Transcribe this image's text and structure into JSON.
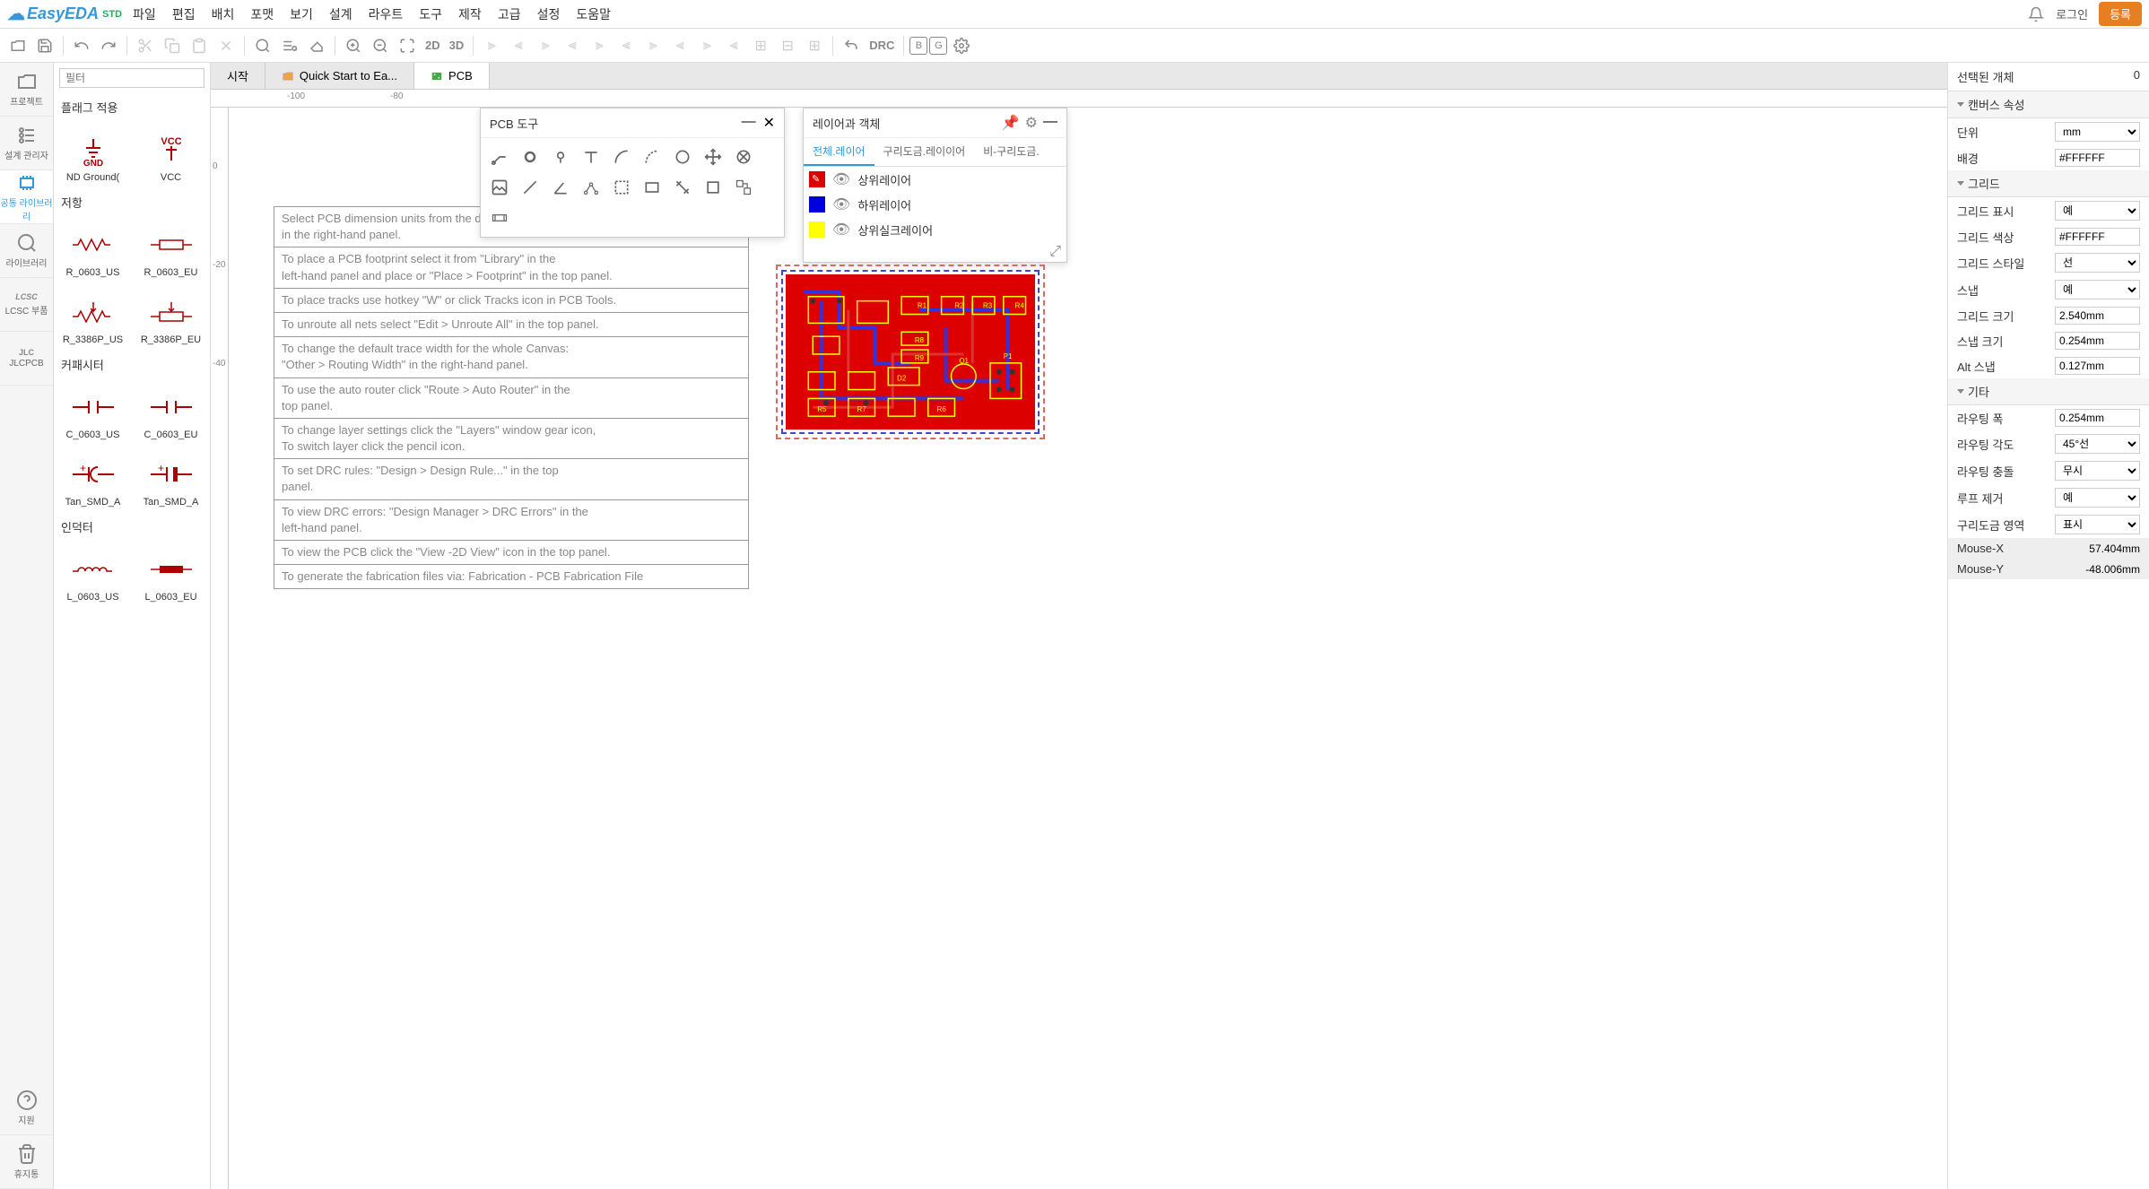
{
  "topbar": {
    "logo": "EasyEDA",
    "logo_suffix": "STD",
    "menus": [
      "파일",
      "편집",
      "배치",
      "포맷",
      "보기",
      "설계",
      "라우트",
      "도구",
      "제작",
      "고급",
      "설정",
      "도움말"
    ],
    "login": "로그인",
    "register": "등록"
  },
  "toolbar": {
    "t2d": "2D",
    "t3d": "3D",
    "drc": "DRC"
  },
  "rail": [
    {
      "label": "프로젝트",
      "icon": "folder"
    },
    {
      "label": "설계 관리자",
      "icon": "list"
    },
    {
      "label": "공통 라이브러리",
      "icon": "chip",
      "active": true
    },
    {
      "label": "라이브러리",
      "icon": "search"
    },
    {
      "label": "LCSC 부품",
      "icon": "lcsc"
    },
    {
      "label": "JLCPCB",
      "icon": "jlc"
    },
    {
      "label": "지원",
      "icon": "help"
    },
    {
      "label": "휴지통",
      "icon": "trash"
    }
  ],
  "libpanel": {
    "filter_ph": "필터",
    "sections": [
      {
        "title": "플래그 적용",
        "items": [
          {
            "name": "ND Ground("
          },
          {
            "name": "VCC",
            "extra": "VCC"
          }
        ]
      },
      {
        "title": "저항",
        "items": [
          {
            "name": "R_0603_US"
          },
          {
            "name": "R_0603_EU"
          },
          {
            "name": "R_3386P_US"
          },
          {
            "name": "R_3386P_EU"
          }
        ]
      },
      {
        "title": "커패시터",
        "items": [
          {
            "name": "C_0603_US"
          },
          {
            "name": "C_0603_EU"
          },
          {
            "name": "Tan_SMD_A"
          },
          {
            "name": "Tan_SMD_A"
          }
        ]
      },
      {
        "title": "인덕터",
        "items": [
          {
            "name": "L_0603_US"
          },
          {
            "name": "L_0603_EU"
          }
        ]
      }
    ]
  },
  "tabs": [
    {
      "label": "시작"
    },
    {
      "label": "Quick Start to Ea...",
      "icon": "folder"
    },
    {
      "label": "PCB",
      "icon": "pcb",
      "active": true
    }
  ],
  "ruler_h": [
    "-100",
    "-80"
  ],
  "ruler_v": [
    "0",
    "-20",
    "-40"
  ],
  "instructions": [
    "Select PCB dimension units from the drop-down list in \"Units\"\nin the right-hand panel.",
    "To place a PCB footprint select it from \"Library\" in the\nleft-hand panel and place or \"Place > Footprint\" in the top panel.",
    "To place tracks use hotkey \"W\" or click Tracks icon in PCB Tools.",
    "To unroute all nets select \"Edit > Unroute All\" in the top panel.",
    "To change the default trace width for the whole Canvas:\n\"Other > Routing Width\" in the right-hand panel.",
    "To use the auto router click \"Route > Auto Router\" in the\ntop panel.",
    "To change layer settings click the \"Layers\" window gear icon,\nTo switch layer click the pencil icon.",
    "To set DRC rules: \"Design > Design Rule...\" in the top\npanel.",
    "To view DRC errors: \"Design Manager > DRC Errors\" in the\nleft-hand panel.",
    "To view the PCB click the \"View -2D View\" icon in the top panel.",
    "To generate the fabrication files via: Fabrication - PCB Fabrication File"
  ],
  "pcbtools": {
    "title": "PCB 도구"
  },
  "layers": {
    "title": "레이어과 객체",
    "tabs": [
      "전체.레이어",
      "구리도금.레이이어",
      "비-구리도금."
    ],
    "rows": [
      {
        "color": "#d00",
        "name": "상위레이어",
        "pencil": true
      },
      {
        "color": "#00d",
        "name": "하위레이어"
      },
      {
        "color": "#ff0",
        "name": "상위실크레이어"
      }
    ]
  },
  "props": {
    "sel_label": "선택된 개체",
    "sel_count": "0",
    "sections": {
      "canvas": "캔버스 속성",
      "grid": "그리드",
      "other": "기타"
    },
    "rows": [
      {
        "sec": "canvas",
        "label": "단위",
        "val": "mm",
        "type": "select"
      },
      {
        "sec": "canvas",
        "label": "배경",
        "val": "#FFFFFF",
        "type": "input"
      },
      {
        "sec": "grid",
        "label": "그리드 표시",
        "val": "예",
        "type": "select"
      },
      {
        "sec": "grid",
        "label": "그리드 색상",
        "val": "#FFFFFF",
        "type": "input"
      },
      {
        "sec": "grid",
        "label": "그리드 스타일",
        "val": "선",
        "type": "select"
      },
      {
        "sec": "grid",
        "label": "스냅",
        "val": "예",
        "type": "select"
      },
      {
        "sec": "grid",
        "label": "그리드 크기",
        "val": "2.540mm",
        "type": "input"
      },
      {
        "sec": "grid",
        "label": "스냅 크기",
        "val": "0.254mm",
        "type": "input"
      },
      {
        "sec": "grid",
        "label": "Alt 스냅",
        "val": "0.127mm",
        "type": "input"
      },
      {
        "sec": "other",
        "label": "라우팅 폭",
        "val": "0.254mm",
        "type": "input"
      },
      {
        "sec": "other",
        "label": "라우팅 각도",
        "val": "45°선",
        "type": "select"
      },
      {
        "sec": "other",
        "label": "라우팅 충돌",
        "val": "무시",
        "type": "select"
      },
      {
        "sec": "other",
        "label": "루프 제거",
        "val": "예",
        "type": "select"
      },
      {
        "sec": "other",
        "label": "구리도금 영역",
        "val": "표시",
        "type": "select"
      }
    ],
    "mouse": [
      {
        "label": "Mouse-X",
        "val": "57.404mm"
      },
      {
        "label": "Mouse-Y",
        "val": "-48.006mm"
      }
    ]
  }
}
